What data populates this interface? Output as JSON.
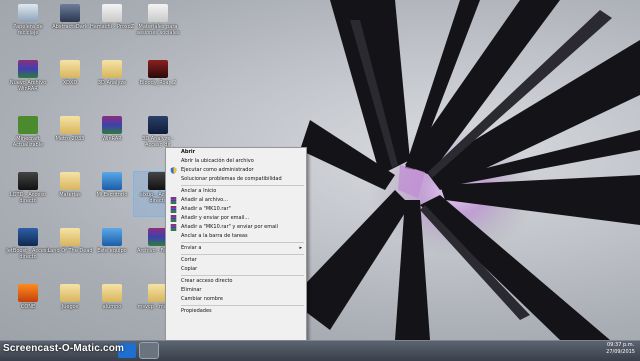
{
  "desktop": {
    "icons": [
      {
        "label": "Papelera de reciclaje",
        "icon": "recycle-bin-icon"
      },
      {
        "label": "AbstractsDark",
        "icon": "image-icon"
      },
      {
        "label": "Hamachi - ProxoZ",
        "icon": "document-icon"
      },
      {
        "label": "Materiales para sesiones sociales",
        "icon": "document-icon"
      },
      {
        "label": "Nuevo Archivo WinRAR",
        "icon": "winrar-icon"
      },
      {
        "label": "XDXD",
        "icon": "folder-icon"
      },
      {
        "label": "3D Analyze",
        "icon": "folder-icon"
      },
      {
        "label": "Bloody_Roar_2",
        "icon": "game-icon"
      },
      {
        "label": "Minecraft Actualizable",
        "icon": "minecraft-icon"
      },
      {
        "label": "Metro 2033",
        "icon": "folder-icon"
      },
      {
        "label": "WinRAR",
        "icon": "winrar-icon"
      },
      {
        "label": "3D Analyze - Acceso dir",
        "icon": "3d-analyze-icon"
      },
      {
        "label": "LOTD - Acceso directo",
        "icon": "game-icon"
      },
      {
        "label": "Materias",
        "icon": "folder-icon"
      },
      {
        "label": "Mi Escritorio",
        "icon": "monitor-icon"
      },
      {
        "label": "sixup - Acceso directo",
        "icon": "game-icon"
      },
      {
        "label": "JetBoost - Acceso directo",
        "icon": "jetboost-icon"
      },
      {
        "label": "Land Of The Dead",
        "icon": "folder-icon"
      },
      {
        "label": "Este equipo",
        "icon": "computer-icon"
      },
      {
        "label": "Archivo - Fallarte",
        "icon": "winrar-icon"
      },
      {
        "label": "CONE",
        "icon": "cone-icon"
      },
      {
        "label": "Juegos",
        "icon": "folder-icon"
      },
      {
        "label": "alumno",
        "icon": "folder-icon"
      },
      {
        "label": "msvcp - msvcp1",
        "icon": "folder-icon"
      }
    ]
  },
  "context_menu": {
    "items": [
      {
        "label": "Abrir",
        "bold": true
      },
      {
        "label": "Abrir la ubicación del archivo"
      },
      {
        "label": "Ejecutar como administrador",
        "icon": "shield-icon"
      },
      {
        "label": "Solucionar problemas de compatibilidad"
      },
      {
        "separator": true
      },
      {
        "label": "Anclar a Inicio"
      },
      {
        "label": "Añadir al archivo...",
        "icon": "winrar-icon"
      },
      {
        "label": "Añadir a \"MK10.rar\"",
        "icon": "winrar-icon"
      },
      {
        "label": "Añadir y enviar por email...",
        "icon": "winrar-icon"
      },
      {
        "label": "Añadir a \"MK10.rar\" y enviar por email",
        "icon": "winrar-icon"
      },
      {
        "label": "Anclar a la barra de tareas"
      },
      {
        "separator": true
      },
      {
        "label": "Enviar a",
        "submenu": true
      },
      {
        "separator": true
      },
      {
        "label": "Cortar"
      },
      {
        "label": "Copiar"
      },
      {
        "separator": true
      },
      {
        "label": "Crear acceso directo"
      },
      {
        "label": "Eliminar"
      },
      {
        "label": "Cambiar nombre"
      },
      {
        "separator": true
      },
      {
        "label": "Propiedades"
      }
    ]
  },
  "taskbar": {
    "watermark": "Screencast-O-Matic.com",
    "clock_time": "09:37 p.m.",
    "clock_date": "27/09/2015"
  },
  "colors": {
    "menu_bg": "#f0f0f0",
    "taskbar": "#39404b",
    "wallpaper_accent": "#c09ad0"
  }
}
